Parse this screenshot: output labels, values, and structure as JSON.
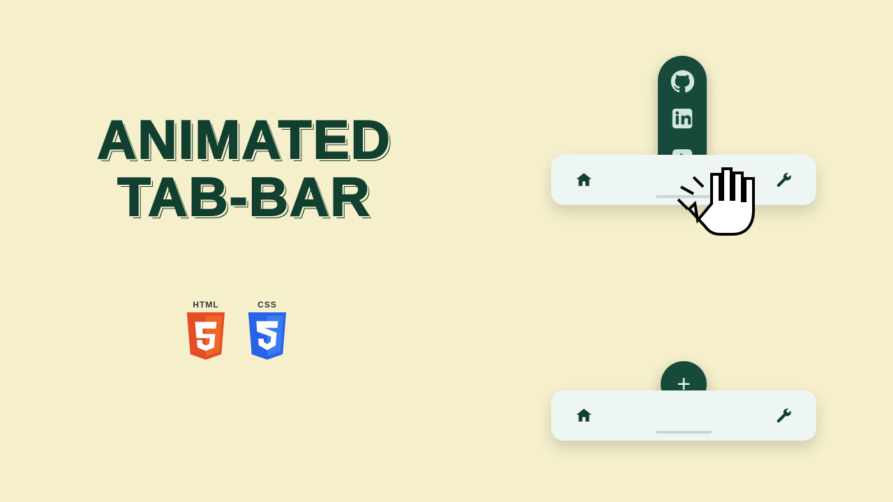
{
  "title": {
    "line1": "ANIMATED",
    "line2": "TAB-BAR"
  },
  "tech": {
    "html": "HTML",
    "css": "CSS"
  },
  "tabbar": {
    "home": "home-icon",
    "tools": "wrench-icon",
    "fab_plus": "+"
  },
  "social": {
    "github": "github-icon",
    "linkedin": "linkedin-icon",
    "youtube": "youtube-icon"
  },
  "colors": {
    "bg": "#f5f0cb",
    "brand": "#174a3a",
    "tabbar_bg": "#eef6f3",
    "html_shield": "#e44d26",
    "css_shield": "#2862e9"
  }
}
